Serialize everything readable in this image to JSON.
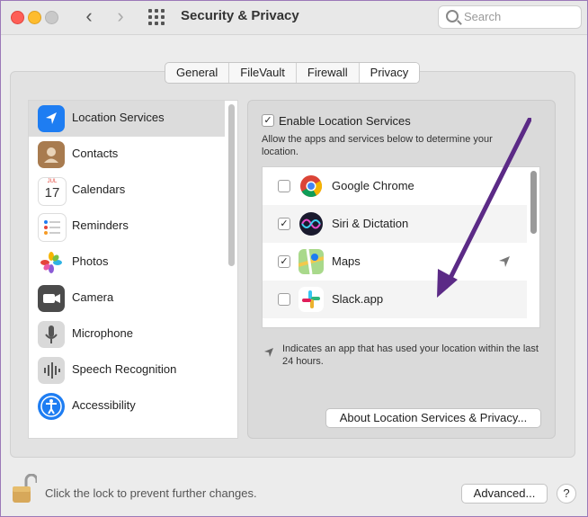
{
  "window": {
    "title": "Security & Privacy",
    "search_placeholder": "Search"
  },
  "tabs": [
    {
      "label": "General",
      "active": false
    },
    {
      "label": "FileVault",
      "active": false
    },
    {
      "label": "Firewall",
      "active": false
    },
    {
      "label": "Privacy",
      "active": true
    }
  ],
  "sidebar": {
    "items": [
      {
        "label": "Location Services",
        "icon": "location-arrow-icon",
        "selected": true
      },
      {
        "label": "Contacts",
        "icon": "contacts-icon",
        "selected": false
      },
      {
        "label": "Calendars",
        "icon": "calendar-icon",
        "selected": false
      },
      {
        "label": "Reminders",
        "icon": "reminders-icon",
        "selected": false
      },
      {
        "label": "Photos",
        "icon": "photos-icon",
        "selected": false
      },
      {
        "label": "Camera",
        "icon": "camera-icon",
        "selected": false
      },
      {
        "label": "Microphone",
        "icon": "microphone-icon",
        "selected": false
      },
      {
        "label": "Speech Recognition",
        "icon": "speech-waveform-icon",
        "selected": false
      },
      {
        "label": "Accessibility",
        "icon": "accessibility-icon",
        "selected": false
      }
    ],
    "calendar_month": "JUL",
    "calendar_day": "17"
  },
  "location": {
    "enable_label": "Enable Location Services",
    "enable_checked": true,
    "description": "Allow the apps and services below to determine your location.",
    "apps": [
      {
        "name": "Google Chrome",
        "checked": false,
        "icon": "chrome-icon",
        "recent": false
      },
      {
        "name": "Siri & Dictation",
        "checked": true,
        "icon": "siri-icon",
        "recent": false
      },
      {
        "name": "Maps",
        "checked": true,
        "icon": "maps-icon",
        "recent": true
      },
      {
        "name": "Slack.app",
        "checked": false,
        "icon": "slack-icon",
        "recent": false
      }
    ],
    "note": "Indicates an app that has used your location within the last 24 hours.",
    "about_button": "About Location Services & Privacy..."
  },
  "footer": {
    "lock_text": "Click the lock to prevent further changes.",
    "advanced_button": "Advanced...",
    "help_label": "?"
  },
  "colors": {
    "annotation_arrow": "#5b2a86",
    "selection": "#dcdcdc",
    "location_icon": "#1e7df2"
  }
}
